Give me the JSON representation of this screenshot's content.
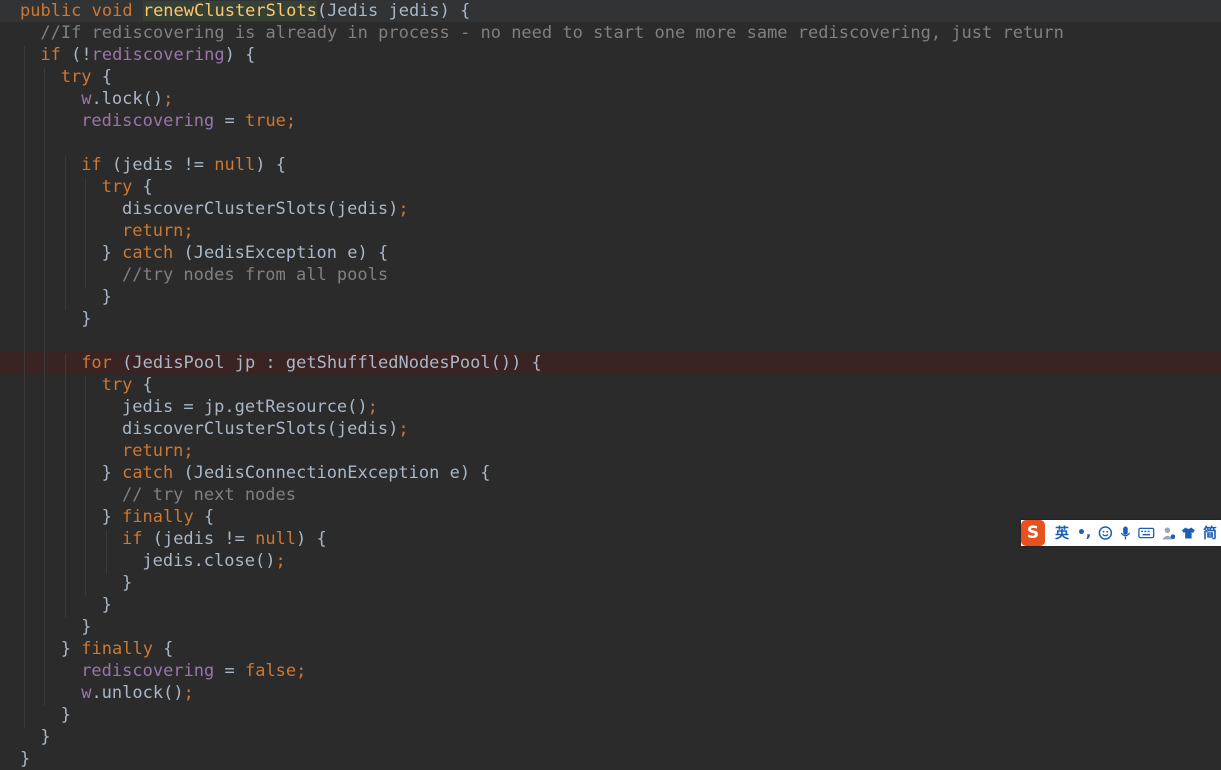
{
  "colors": {
    "background": "#2b2b2b",
    "keyword": "#cc7832",
    "method": "#ffc66d",
    "field": "#9876aa",
    "comment": "#808080",
    "text": "#a9b7c6",
    "highlight_line": "#3a2323"
  },
  "code_lines": [
    [
      {
        "t": "kw",
        "v": "public void "
      },
      {
        "t": "fndecl",
        "v": "renewClusterSlots"
      },
      {
        "t": "text",
        "v": "(Jedis jedis) {"
      }
    ],
    [
      {
        "t": "com",
        "v": "//If rediscovering is already in process - no need to start one more same rediscovering, just return"
      }
    ],
    [
      {
        "t": "kw",
        "v": "if "
      },
      {
        "t": "text",
        "v": "(!"
      },
      {
        "t": "field",
        "v": "rediscovering"
      },
      {
        "t": "text",
        "v": ") {"
      }
    ],
    [
      {
        "t": "kw",
        "v": "try "
      },
      {
        "t": "text",
        "v": "{"
      }
    ],
    [
      {
        "t": "field",
        "v": "w"
      },
      {
        "t": "text",
        "v": ".lock()"
      },
      {
        "t": "kw",
        "v": ";"
      }
    ],
    [
      {
        "t": "field",
        "v": "rediscovering "
      },
      {
        "t": "text",
        "v": "= "
      },
      {
        "t": "kw",
        "v": "true;"
      }
    ],
    [],
    [
      {
        "t": "kw",
        "v": "if "
      },
      {
        "t": "text",
        "v": "(jedis != "
      },
      {
        "t": "kw",
        "v": "null"
      },
      {
        "t": "text",
        "v": ") {"
      }
    ],
    [
      {
        "t": "kw",
        "v": "try "
      },
      {
        "t": "text",
        "v": "{"
      }
    ],
    [
      {
        "t": "text",
        "v": "discoverClusterSlots(jedis)"
      },
      {
        "t": "kw",
        "v": ";"
      }
    ],
    [
      {
        "t": "kw",
        "v": "return;"
      }
    ],
    [
      {
        "t": "text",
        "v": "} "
      },
      {
        "t": "kw",
        "v": "catch "
      },
      {
        "t": "text",
        "v": "(JedisException e) {"
      }
    ],
    [
      {
        "t": "com",
        "v": "//try nodes from all pools"
      }
    ],
    [
      {
        "t": "text",
        "v": "}"
      }
    ],
    [
      {
        "t": "text",
        "v": "}"
      }
    ],
    [],
    [
      {
        "t": "kw",
        "v": "for "
      },
      {
        "t": "text",
        "v": "(JedisPool jp : getShuffledNodesPool()) {"
      }
    ],
    [
      {
        "t": "kw",
        "v": "try "
      },
      {
        "t": "text",
        "v": "{"
      }
    ],
    [
      {
        "t": "text",
        "v": "jedis = jp.getResource()"
      },
      {
        "t": "kw",
        "v": ";"
      }
    ],
    [
      {
        "t": "text",
        "v": "discoverClusterSlots(jedis)"
      },
      {
        "t": "kw",
        "v": ";"
      }
    ],
    [
      {
        "t": "kw",
        "v": "return;"
      }
    ],
    [
      {
        "t": "text",
        "v": "} "
      },
      {
        "t": "kw",
        "v": "catch "
      },
      {
        "t": "text",
        "v": "(JedisConnectionException e) {"
      }
    ],
    [
      {
        "t": "com",
        "v": "// try next nodes"
      }
    ],
    [
      {
        "t": "text",
        "v": "} "
      },
      {
        "t": "kw",
        "v": "finally "
      },
      {
        "t": "text",
        "v": "{"
      }
    ],
    [
      {
        "t": "kw",
        "v": "if "
      },
      {
        "t": "text",
        "v": "(jedis != "
      },
      {
        "t": "kw",
        "v": "null"
      },
      {
        "t": "text",
        "v": ") {"
      }
    ],
    [
      {
        "t": "text",
        "v": "jedis.close()"
      },
      {
        "t": "kw",
        "v": ";"
      }
    ],
    [
      {
        "t": "text",
        "v": "}"
      }
    ],
    [
      {
        "t": "text",
        "v": "}"
      }
    ],
    [
      {
        "t": "text",
        "v": "}"
      }
    ],
    [
      {
        "t": "text",
        "v": "} "
      },
      {
        "t": "kw",
        "v": "finally "
      },
      {
        "t": "text",
        "v": "{"
      }
    ],
    [
      {
        "t": "field",
        "v": "rediscovering "
      },
      {
        "t": "text",
        "v": "= "
      },
      {
        "t": "kw",
        "v": "false;"
      }
    ],
    [
      {
        "t": "field",
        "v": "w"
      },
      {
        "t": "text",
        "v": ".unlock()"
      },
      {
        "t": "kw",
        "v": ";"
      }
    ],
    [
      {
        "t": "text",
        "v": "}"
      }
    ],
    [
      {
        "t": "text",
        "v": "}"
      }
    ],
    [
      {
        "t": "text",
        "v": "}"
      }
    ]
  ],
  "ime_toolbar": {
    "logo": "S",
    "mode_label": "英",
    "punct_label": "•,",
    "trailing_label": "简",
    "icons": [
      "smiley-icon",
      "microphone-icon",
      "keyboard-icon",
      "user-icon",
      "tshirt-icon"
    ]
  }
}
